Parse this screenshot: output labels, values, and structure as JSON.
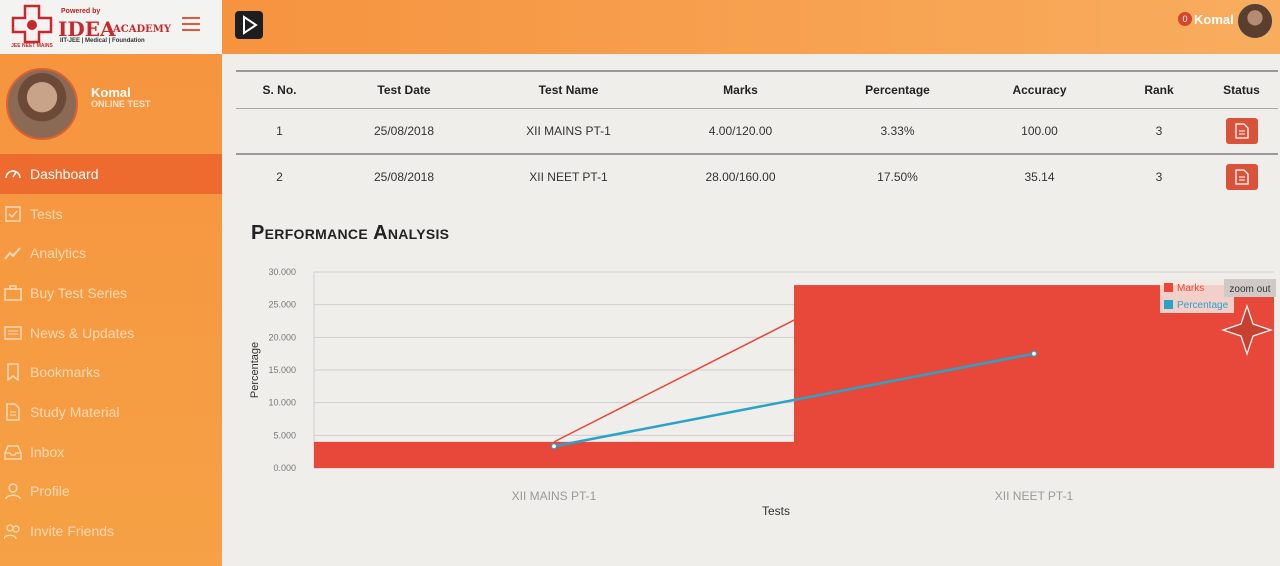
{
  "logo": {
    "mark_text": "JEE NEET MAINS",
    "powered_by": "Powered by",
    "brand": "IDEA",
    "brand_suffix": "ACADEMY",
    "tagline": "IIT-JEE | Medical | Foundation",
    "color": "#c8282c"
  },
  "header": {
    "notification_count": "0",
    "user_name": "Komal"
  },
  "profile": {
    "name": "Komal",
    "role": "ONLINE TEST"
  },
  "sidebar": {
    "items": [
      {
        "label": "Dashboard",
        "icon": "speedometer-icon",
        "active": true
      },
      {
        "label": "Tests",
        "icon": "checklist-icon"
      },
      {
        "label": "Analytics",
        "icon": "trend-icon"
      },
      {
        "label": "Buy Test Series",
        "icon": "briefcase-icon"
      },
      {
        "label": "News & Updates",
        "icon": "newspaper-icon"
      },
      {
        "label": "Bookmarks",
        "icon": "bookmark-icon"
      },
      {
        "label": "Study Material",
        "icon": "document-icon"
      },
      {
        "label": "Inbox",
        "icon": "inbox-icon"
      },
      {
        "label": "Profile",
        "icon": "user-icon"
      },
      {
        "label": "Invite Friends",
        "icon": "users-icon"
      }
    ]
  },
  "table": {
    "headers": [
      "S. No.",
      "Test Date",
      "Test Name",
      "Marks",
      "Percentage",
      "Accuracy",
      "Rank",
      "Status"
    ],
    "rows": [
      [
        "1",
        "25/08/2018",
        "XII MAINS PT-1",
        "4.00/120.00",
        "3.33%",
        "100.00",
        "3"
      ],
      [
        "2",
        "25/08/2018",
        "XII NEET PT-1",
        "28.00/160.00",
        "17.50%",
        "35.14",
        "3"
      ]
    ]
  },
  "performance": {
    "title": "Performance Analysis",
    "zoom_out": "zoom out"
  },
  "chart_data": {
    "type": "bar",
    "categories": [
      "XII MAINS PT-1",
      "XII NEET PT-1"
    ],
    "series": [
      {
        "name": "Marks",
        "type": "bar",
        "values": [
          4.0,
          28.0
        ],
        "color": "#e8483a"
      },
      {
        "name": "Percentage",
        "type": "line",
        "values": [
          3.33,
          17.5
        ],
        "color": "#2ba3c9"
      }
    ],
    "xlabel": "Tests",
    "ylabel": "Percentage",
    "ylim": [
      0,
      30
    ],
    "yticks": [
      "0.000",
      "5.000",
      "10.000",
      "15.000",
      "20.000",
      "25.000",
      "30.000"
    ],
    "legend": "top-right",
    "grid": true
  }
}
